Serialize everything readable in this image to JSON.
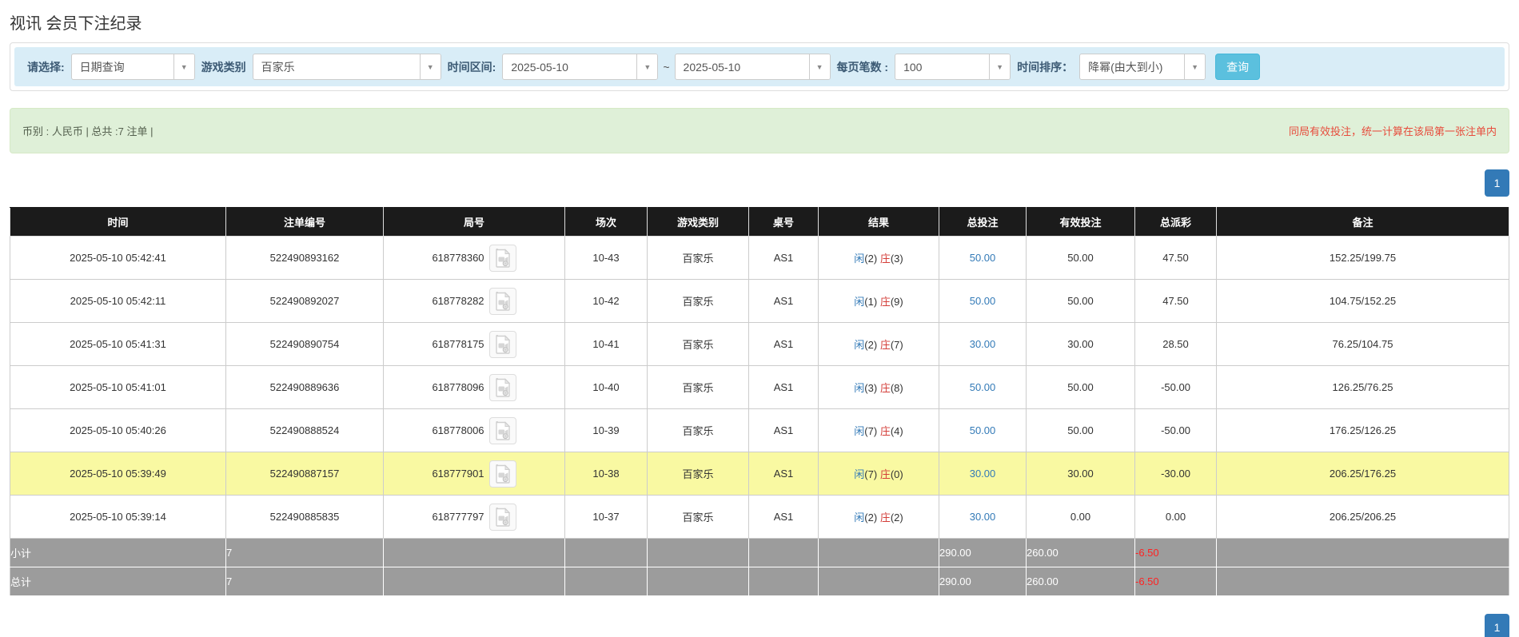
{
  "page": {
    "title": "视讯 会员下注纪录"
  },
  "filter": {
    "query_type": {
      "label": "请选择:",
      "value": "日期查询"
    },
    "game_type": {
      "label": "游戏类别",
      "value": "百家乐"
    },
    "time_range": {
      "label": "时间区间:",
      "from": "2025-05-10",
      "separator": "~",
      "to": "2025-05-10"
    },
    "page_size": {
      "label": "每页笔数 :",
      "value": "100"
    },
    "time_sort": {
      "label": "时间排序：",
      "value": "降幂(由大到小)"
    },
    "search_button": "查询",
    "chevron_icon": "▼"
  },
  "summary_bar": {
    "left": "币别 : 人民币 | 总共 :7 注单 |",
    "right": "同局有效投注，统一计算在该局第一张注单内"
  },
  "pagination": {
    "page": "1"
  },
  "table": {
    "headers": [
      "时间",
      "注单编号",
      "局号",
      "场次",
      "游戏类别",
      "桌号",
      "结果",
      "总投注",
      "有效投注",
      "总派彩",
      "备注"
    ],
    "rows": [
      {
        "time": "2025-05-10 05:42:41",
        "bet_no": "522490893162",
        "round_no": "618778360",
        "session": "10-43",
        "game": "百家乐",
        "table_no": "AS1",
        "result_player": "闲(2)",
        "result_banker": "庄(3)",
        "total_bet": "50.00",
        "valid_bet": "50.00",
        "payout": "47.50",
        "note": "152.25/199.75",
        "highlight": false
      },
      {
        "time": "2025-05-10 05:42:11",
        "bet_no": "522490892027",
        "round_no": "618778282",
        "session": "10-42",
        "game": "百家乐",
        "table_no": "AS1",
        "result_player": "闲(1)",
        "result_banker": "庄(9)",
        "total_bet": "50.00",
        "valid_bet": "50.00",
        "payout": "47.50",
        "note": "104.75/152.25",
        "highlight": false
      },
      {
        "time": "2025-05-10 05:41:31",
        "bet_no": "522490890754",
        "round_no": "618778175",
        "session": "10-41",
        "game": "百家乐",
        "table_no": "AS1",
        "result_player": "闲(2)",
        "result_banker": "庄(7)",
        "total_bet": "30.00",
        "valid_bet": "30.00",
        "payout": "28.50",
        "note": "76.25/104.75",
        "highlight": false
      },
      {
        "time": "2025-05-10 05:41:01",
        "bet_no": "522490889636",
        "round_no": "618778096",
        "session": "10-40",
        "game": "百家乐",
        "table_no": "AS1",
        "result_player": "闲(3)",
        "result_banker": "庄(8)",
        "total_bet": "50.00",
        "valid_bet": "50.00",
        "payout": "-50.00",
        "note": "126.25/76.25",
        "highlight": false
      },
      {
        "time": "2025-05-10 05:40:26",
        "bet_no": "522490888524",
        "round_no": "618778006",
        "session": "10-39",
        "game": "百家乐",
        "table_no": "AS1",
        "result_player": "闲(7)",
        "result_banker": "庄(4)",
        "total_bet": "50.00",
        "valid_bet": "50.00",
        "payout": "-50.00",
        "note": "176.25/126.25",
        "highlight": false
      },
      {
        "time": "2025-05-10 05:39:49",
        "bet_no": "522490887157",
        "round_no": "618777901",
        "session": "10-38",
        "game": "百家乐",
        "table_no": "AS1",
        "result_player": "闲(7)",
        "result_banker": "庄(0)",
        "total_bet": "30.00",
        "valid_bet": "30.00",
        "payout": "-30.00",
        "note": "206.25/176.25",
        "highlight": true
      },
      {
        "time": "2025-05-10 05:39:14",
        "bet_no": "522490885835",
        "round_no": "618777797",
        "session": "10-37",
        "game": "百家乐",
        "table_no": "AS1",
        "result_player": "闲(2)",
        "result_banker": "庄(2)",
        "total_bet": "30.00",
        "valid_bet": "0.00",
        "payout": "0.00",
        "note": "206.25/206.25",
        "highlight": false
      }
    ],
    "summary_rows": [
      {
        "label": "小计",
        "count": "7",
        "total_bet": "290.00",
        "valid_bet": "260.00",
        "payout": "-6.50"
      },
      {
        "label": "总计",
        "count": "7",
        "total_bet": "290.00",
        "valid_bet": "260.00",
        "payout": "-6.50"
      }
    ]
  },
  "colors": {
    "accent_blue": "#337ab7",
    "search_button_bg": "#5bc0de",
    "filter_strip_bg": "#d9edf7",
    "alert_bg": "#dff0d8",
    "notice_red": "#e74c3c",
    "header_bg": "#1b1b1b",
    "highlight_row": "#f9f9a2",
    "summary_row_bg": "#9c9c9c",
    "negative_red": "#e60000",
    "player_blue": "#337ab7",
    "banker_red": "#d43f3a"
  }
}
